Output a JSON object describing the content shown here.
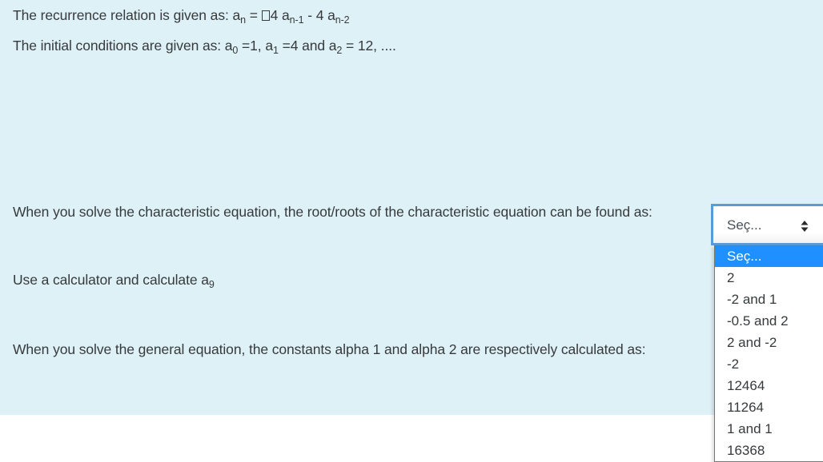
{
  "question": {
    "recurrence": {
      "prefix": "The recurrence relation is given as: a",
      "sub_n": "n",
      "equals": " = ",
      "missing_glyph": "",
      "coef1": "4 a",
      "sub_n1": "n-1",
      "minus": " - 4 a",
      "sub_n2": "n-2"
    },
    "initial": {
      "prefix": "The initial conditions are given as:  a",
      "sub0": "0",
      "v0": " =1, a",
      "sub1": "1",
      "v1": " =4 and a",
      "sub2": "2",
      "v2": " = 12, ...."
    },
    "part1": "When you solve the characteristic equation, the root/roots of the characteristic equation can be found as:",
    "part2_prefix": "Use a calculator and calculate a",
    "part2_sub": "9",
    "part3": "When you solve the general equation, the constants alpha 1 and alpha 2 are respectively calculated as:"
  },
  "select": {
    "value": "Seç...",
    "icon": "updown-arrows-icon",
    "options": [
      {
        "label": "Seç...",
        "selected": true
      },
      {
        "label": "2"
      },
      {
        "label": "-2 and 1"
      },
      {
        "label": "-0.5 and 2"
      },
      {
        "label": "2 and -2"
      },
      {
        "label": "-2"
      },
      {
        "label": "12464"
      },
      {
        "label": "11264"
      },
      {
        "label": "1 and 1"
      },
      {
        "label": "16368"
      }
    ]
  },
  "colors": {
    "panel_bg": "#def1f7",
    "focus_border": "#5b9bd5",
    "highlight": "#1e90ff"
  }
}
